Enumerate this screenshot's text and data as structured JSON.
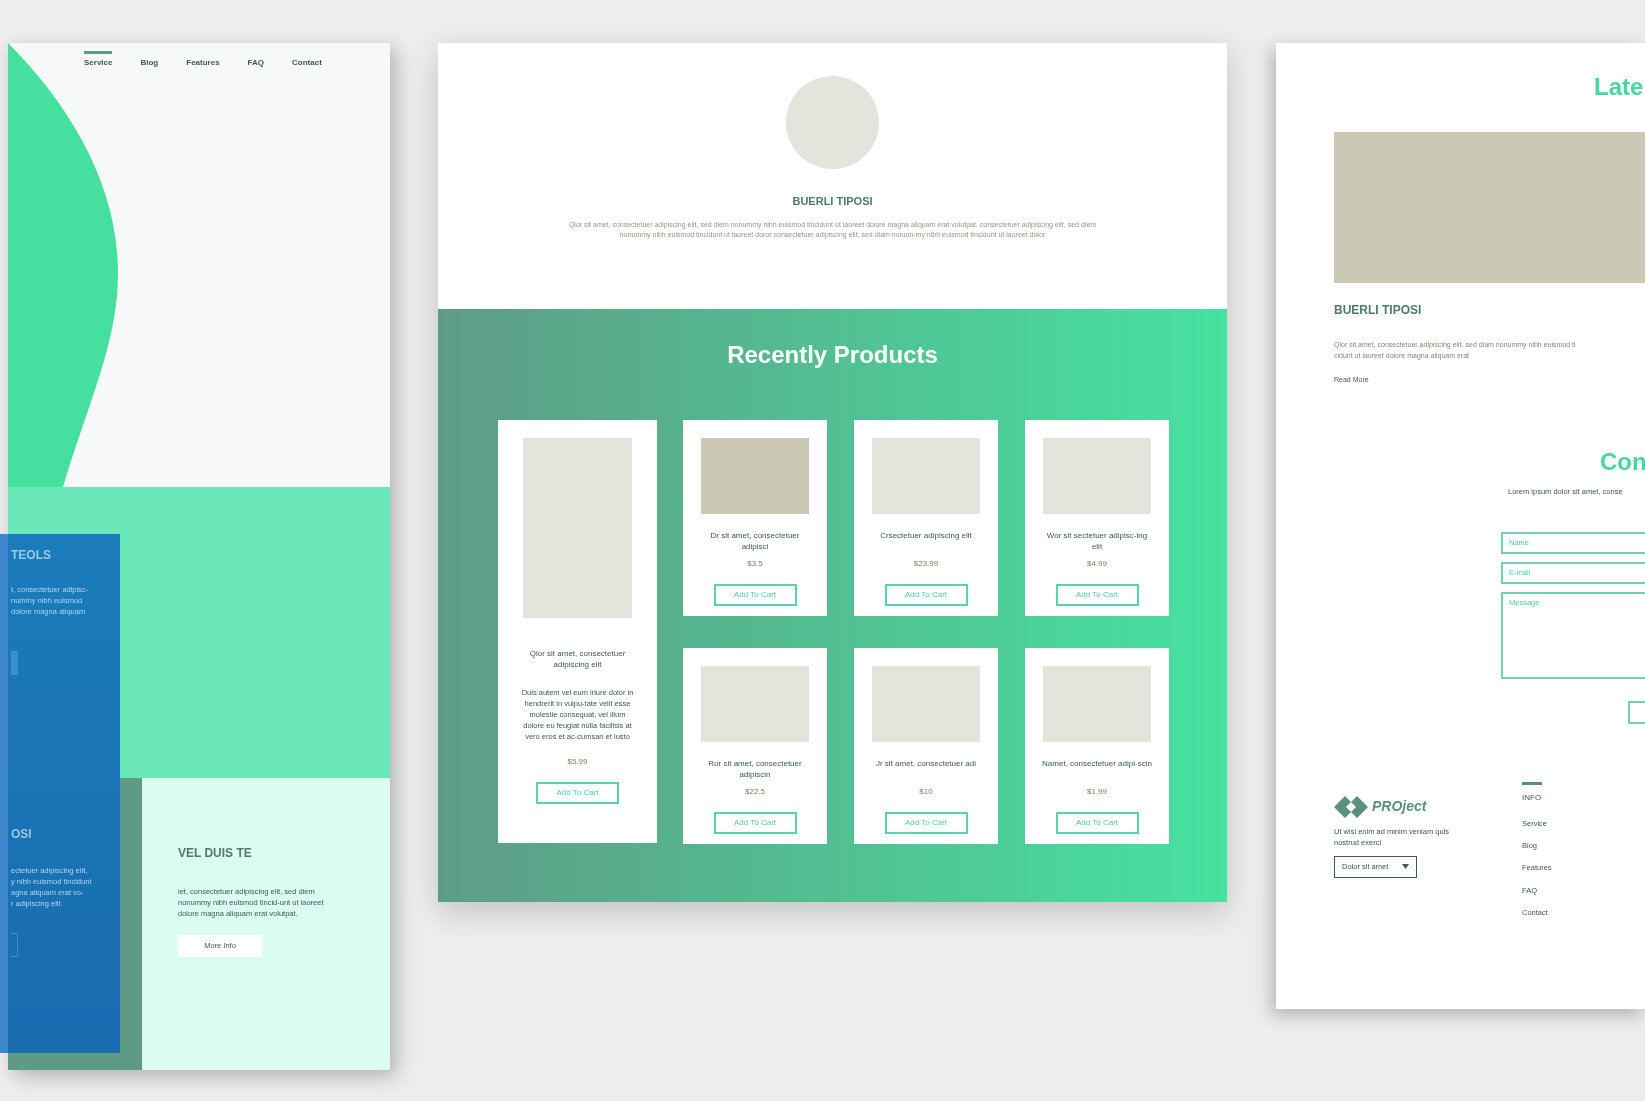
{
  "left_page": {
    "nav": [
      {
        "label": "Service",
        "selected": true
      },
      {
        "label": "Blog",
        "selected": false
      },
      {
        "label": "Features",
        "selected": false
      },
      {
        "label": "FAQ",
        "selected": false
      },
      {
        "label": "Contact",
        "selected": false
      }
    ],
    "overlay": {
      "title_1": "TEOLS",
      "text_1": [
        "t, consectetuer adipisc-",
        "nummy nibh euismod",
        "dolore magna aliquam"
      ],
      "title_2": "OSI",
      "text_2": [
        "ectetuer adipiscing elit,",
        "y nibh euismod tincidunt",
        "agna aliquam erat vo-",
        "r adipiscing elit."
      ]
    },
    "feature": {
      "title": "VEL DUIS TE",
      "text": "iet, consectetuer adipiscing elit, sed diem nonummy nibh euismod tincid-unt ut laoreet dolore magna aliquam erat volutpat.",
      "button": "More Info"
    }
  },
  "center_page": {
    "profile": {
      "name": "BUERLI TIPOSI",
      "text": "Qlor sit amet, consectetuer adipiscing elit, sed diem nonummy nibh euismod tincidunt ut laoreet dolore magna aliquam erat volutpat. consectetuer adipiscing elit, sed diem nonummy nibh euismod tincidunt ut laoreet doror consectetuer adipiscing elit, sed diam nonum-my nibh euismod tincidunt ut laoreet dolor"
    },
    "products_title": "Recently Products",
    "featured_product": {
      "name": "Qlor sit amet, consectetuer adipiscing elit",
      "description": "Duis autem vel eum iriure dolor in hendrerit in vulpu-tate velit esse molestie consequat, vel illum dolore eu feugiat nulla facilisis at vero eros et ac-cumsan et iusto",
      "price": "$5.99",
      "button": "Add To Cart"
    },
    "products": [
      {
        "name": "Dr sit amet, consectetuer adipisci",
        "price": "$3.5",
        "button": "Add To Cart",
        "highlighted": true
      },
      {
        "name": "Crsectetuer adipiscing elit",
        "price": "$23.99",
        "button": "Add To Cart",
        "highlighted": false
      },
      {
        "name": "Wor sit sectetuer adipisc-ing elit",
        "price": "$4.99",
        "button": "Add To Cart",
        "highlighted": false
      },
      {
        "name": "Ror sit amet, consectetuer adipiscin",
        "price": "$22.5",
        "button": "Add To Cart",
        "highlighted": false
      },
      {
        "name": "Jr sit amet, consectetuer adi",
        "price": "$10",
        "button": "Add To Cart",
        "highlighted": false
      },
      {
        "name": "Namet, consectetuer adipi-scin",
        "price": "$1.99",
        "button": "Add To Cart",
        "highlighted": false
      }
    ]
  },
  "right_page": {
    "latest_title": "Late",
    "post": {
      "title": "BUERLI TIPOSI",
      "text": [
        "Qlor sit amet, consectetuer adipiscing elit, sed diam nonummy nibh euismod ti",
        "cidunt ut laoreet dolore magna aliquam erat"
      ],
      "link": "Read More"
    },
    "contact": {
      "title": "Con",
      "text": "Lorem ipsum dolor sit amet, conse",
      "fields": [
        {
          "placeholder": "Name",
          "kind": "line"
        },
        {
          "placeholder": "E-mail",
          "kind": "line"
        },
        {
          "placeholder": "Message",
          "kind": "area"
        }
      ]
    },
    "footer": {
      "brand": "PROject",
      "text": "Ut wisi enim ad minim veniam quis nostrud exerci",
      "dropdown": "Dolor sit amet",
      "column_title": "INFO",
      "links": [
        "Service",
        "Blog",
        "Features",
        "FAQ",
        "Contact"
      ]
    }
  }
}
